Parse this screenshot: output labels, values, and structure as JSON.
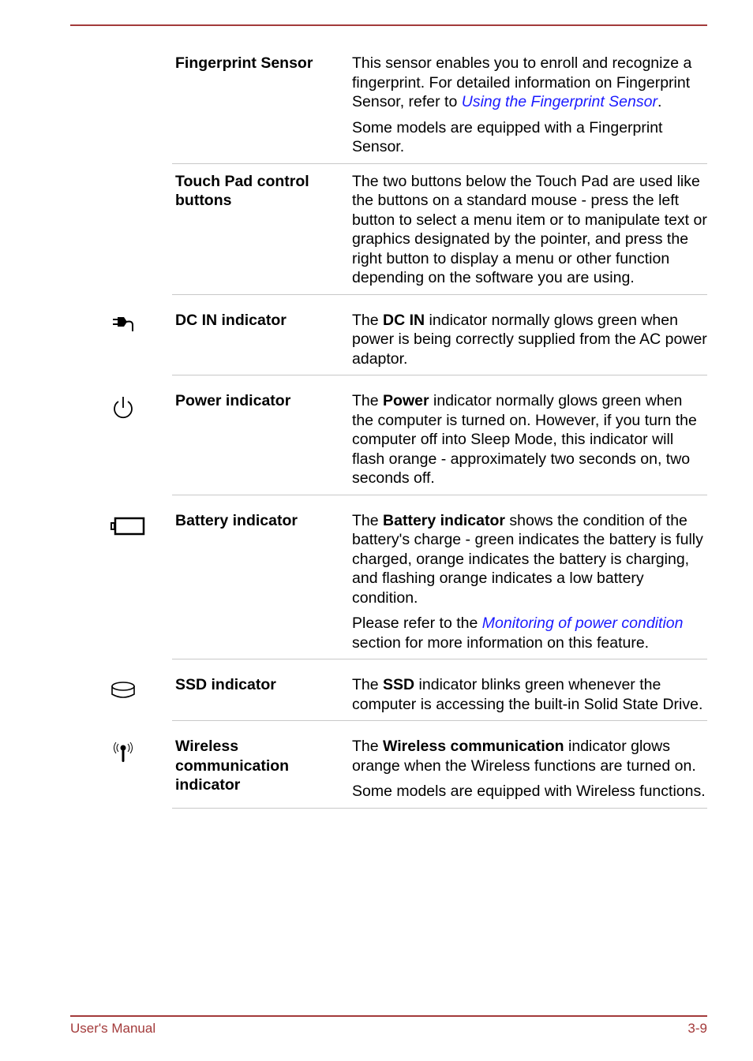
{
  "rows": [
    {
      "label": "Fingerprint Sensor",
      "icon": null,
      "p1_pre": "This sensor enables you to enroll and recognize a fingerprint. For detailed information on Fingerprint Sensor, refer to ",
      "p1_link": "Using the Fingerprint Sensor",
      "p1_post": ".",
      "p2": "Some models are equipped with a Fingerprint Sensor."
    },
    {
      "label": "Touch Pad control buttons",
      "icon": null,
      "p1": "The two buttons below the Touch Pad are used like the buttons on a standard mouse - press the left button to select a menu item or to manipulate text or graphics designated by the pointer, and press the right button to display a menu or other function depending on the software you are using."
    },
    {
      "label": "DC IN indicator",
      "icon": "dc-in-plug-icon",
      "p1_pre": "The ",
      "p1_bold": "DC IN",
      "p1_post": " indicator normally glows green when power is being correctly supplied from the AC power adaptor."
    },
    {
      "label": "Power indicator",
      "icon": "power-icon",
      "p1_pre": "The ",
      "p1_bold": "Power",
      "p1_post": " indicator normally glows green when the computer is turned on. However, if you turn the computer off into Sleep Mode, this indicator will flash orange - approximately two seconds on, two seconds off."
    },
    {
      "label": "Battery indicator",
      "icon": "battery-icon",
      "p1_pre": "The ",
      "p1_bold": "Battery indicator",
      "p1_post": " shows the condition of the battery's charge - green indicates the battery is fully charged, orange indicates the battery is charging, and flashing orange indicates a low battery condition.",
      "p2_pre": "Please refer to the ",
      "p2_link": "Monitoring of power condition",
      "p2_post": " section for more information on this feature."
    },
    {
      "label": "SSD indicator",
      "icon": "ssd-drive-icon",
      "p1_pre": "The ",
      "p1_bold": "SSD",
      "p1_post": " indicator blinks green whenever the computer is accessing the built-in Solid State Drive."
    },
    {
      "label": "Wireless communication indicator",
      "icon": "wireless-antenna-icon",
      "p1_pre": "The ",
      "p1_bold": "Wireless communication",
      "p1_post": " indicator glows orange when the Wireless functions are turned on.",
      "p2": "Some models are equipped with Wireless functions."
    }
  ],
  "footer": {
    "left": "User's Manual",
    "right": "3-9"
  },
  "colors": {
    "accent": "#a33a3a",
    "link": "#1a1aff"
  }
}
